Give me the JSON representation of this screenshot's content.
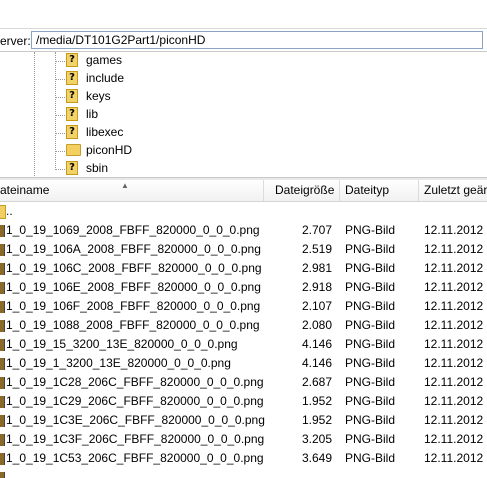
{
  "pathbar": {
    "label": "erver:",
    "path": "/media/DT101G2Part1/piconHD"
  },
  "tree": {
    "items": [
      {
        "label": "games"
      },
      {
        "label": "include"
      },
      {
        "label": "keys"
      },
      {
        "label": "lib"
      },
      {
        "label": "libexec"
      },
      {
        "label": "piconHD",
        "selected": true
      },
      {
        "label": "sbin"
      }
    ]
  },
  "columns": {
    "name": "ateiname",
    "size": "Dateigröße",
    "type": "Dateityp",
    "date": "Zuletzt geär"
  },
  "parent_row": {
    "name": ".."
  },
  "files": [
    {
      "name": "1_0_19_1069_2008_FBFF_820000_0_0_0.png",
      "size": "2.707",
      "type": "PNG-Bild",
      "date": "12.11.2012 1"
    },
    {
      "name": "1_0_19_106A_2008_FBFF_820000_0_0_0.png",
      "size": "2.519",
      "type": "PNG-Bild",
      "date": "12.11.2012 1"
    },
    {
      "name": "1_0_19_106C_2008_FBFF_820000_0_0_0.png",
      "size": "2.981",
      "type": "PNG-Bild",
      "date": "12.11.2012 1"
    },
    {
      "name": "1_0_19_106E_2008_FBFF_820000_0_0_0.png",
      "size": "2.918",
      "type": "PNG-Bild",
      "date": "12.11.2012 1"
    },
    {
      "name": "1_0_19_106F_2008_FBFF_820000_0_0_0.png",
      "size": "2.107",
      "type": "PNG-Bild",
      "date": "12.11.2012 1"
    },
    {
      "name": "1_0_19_1088_2008_FBFF_820000_0_0_0.png",
      "size": "2.080",
      "type": "PNG-Bild",
      "date": "12.11.2012 1"
    },
    {
      "name": "1_0_19_15_3200_13E_820000_0_0_0.png",
      "size": "4.146",
      "type": "PNG-Bild",
      "date": "12.11.2012 1"
    },
    {
      "name": "1_0_19_1_3200_13E_820000_0_0_0.png",
      "size": "4.146",
      "type": "PNG-Bild",
      "date": "12.11.2012 1"
    },
    {
      "name": "1_0_19_1C28_206C_FBFF_820000_0_0_0.png",
      "size": "2.687",
      "type": "PNG-Bild",
      "date": "12.11.2012 1"
    },
    {
      "name": "1_0_19_1C29_206C_FBFF_820000_0_0_0.png",
      "size": "1.952",
      "type": "PNG-Bild",
      "date": "12.11.2012 1"
    },
    {
      "name": "1_0_19_1C3E_206C_FBFF_820000_0_0_0.png",
      "size": "1.952",
      "type": "PNG-Bild",
      "date": "12.11.2012 1"
    },
    {
      "name": "1_0_19_1C3F_206C_FBFF_820000_0_0_0.png",
      "size": "3.205",
      "type": "PNG-Bild",
      "date": "12.11.2012 1"
    },
    {
      "name": "1_0_19_1C53_206C_FBFF_820000_0_0_0.png",
      "size": "3.649",
      "type": "PNG-Bild",
      "date": "12.11.2012 1"
    }
  ]
}
